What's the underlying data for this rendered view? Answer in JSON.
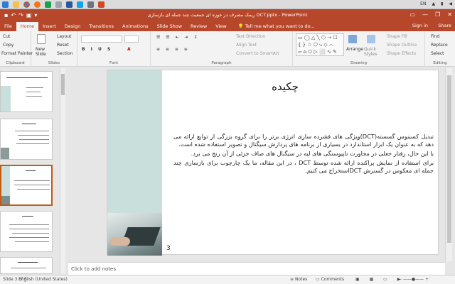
{
  "taskbar": {
    "apps": [
      "explorer",
      "chrome",
      "firefox",
      "edge-like",
      "word",
      "powerpoint",
      "media",
      "store",
      "office"
    ],
    "language": "EN",
    "icons": [
      "chevron-up-icon",
      "network-icon",
      "volume-icon",
      "keyboard-icon"
    ]
  },
  "titlebar": {
    "title": "ریمک مصرف در حوزه ای جمعیت چند جمله ای بازسازی DCT.pptx - PowerPoint",
    "window_controls": [
      "▭",
      "—",
      "❐",
      "✕"
    ]
  },
  "tabs": {
    "items": [
      "File",
      "Home",
      "Insert",
      "Design",
      "Transitions",
      "Animations",
      "Slide Show",
      "Review",
      "View"
    ],
    "active": "Home",
    "tell_me": "Tell me what you want to do...",
    "sign_in": "Sign in",
    "share": "Share"
  },
  "ribbon": {
    "clipboard": {
      "cut": "Cut",
      "copy": "Copy",
      "format_painter": "Format Painter",
      "label": "Clipboard"
    },
    "slides": {
      "new_slide": "New Slide",
      "layout": "Layout",
      "reset": "Reset",
      "section": "Section",
      "label": "Slides"
    },
    "font": {
      "label": "Font"
    },
    "paragraph": {
      "text_direction": "Text Direction",
      "align_text": "Align Text",
      "convert_smartart": "Convert to SmartArt",
      "label": "Paragraph"
    },
    "drawing": {
      "arrange": "Arrange",
      "quick_styles": "Quick Styles",
      "shape_fill": "Shape Fill",
      "shape_outline": "Shape Outline",
      "shape_effects": "Shape Effects",
      "label": "Drawing"
    },
    "editing": {
      "find": "Find",
      "replace": "Replace",
      "select": "Select",
      "label": "Editing"
    }
  },
  "thumbs": {
    "numbers": [
      "1",
      "2",
      "3",
      "4",
      "5"
    ]
  },
  "slide": {
    "title": "چکیده",
    "paragraphs": [
      "تبدیل کسینوس گسسته(DCT)ویژگی های فشرده سازی انرژی برتر را برای گروه بزرگی از توابع ارائه می دهد که به عنوان یک ابزار استاندارد در بسیاری از برنامه های پردازش سیگنال و تصویر استفاده شده است.",
      "با این حال، رفتار جعلی در مجاورت ناپیوستگی های لبه در سیگنال های صاف جزئی از آن رنج می برد.",
      "برای استفاده از نمایش پراکنده ارائه شده توسط DCT ، در این مقاله، ما یک چارچوب برای بازسازی چند جمله ای معکوس در گسترش DCTاستخراج می کنیم."
    ],
    "page_number": "3"
  },
  "notes": {
    "placeholder": "Click to add notes"
  },
  "status": {
    "slide_info": "Slide 3 of 5",
    "language": "English (United States)",
    "notes": "Notes",
    "comments": "Comments"
  },
  "colors": {
    "accent": "#b7472a",
    "slide_band": "#c9dfdc",
    "selected_thumb": "#c55a11"
  }
}
